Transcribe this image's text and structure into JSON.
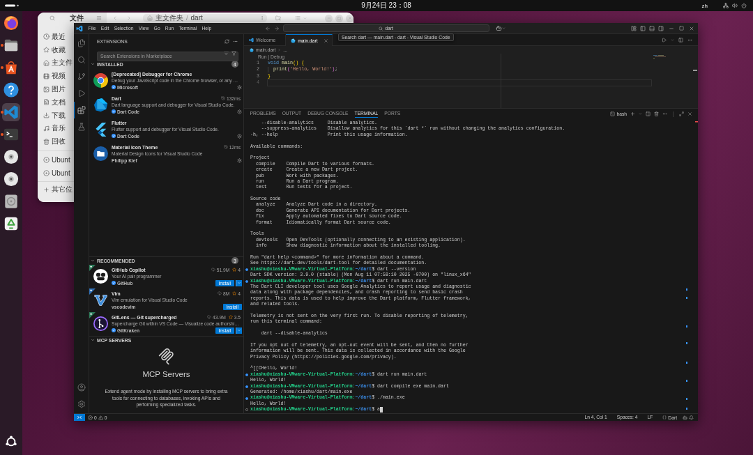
{
  "top_bar": {
    "clock": "9月24日 23：08",
    "input_method": "zh"
  },
  "dock": {
    "items": [
      {
        "kind": "firefox",
        "running": false,
        "selected": false
      },
      {
        "kind": "files",
        "running": true,
        "selected": false
      },
      {
        "kind": "app-center",
        "running": true,
        "selected": false
      },
      {
        "kind": "help",
        "running": false,
        "selected": false
      },
      {
        "kind": "vscode",
        "running": true,
        "selected": true
      },
      {
        "kind": "terminal",
        "running": true,
        "selected": false
      },
      {
        "kind": "disc",
        "running": false,
        "selected": false
      },
      {
        "kind": "disc",
        "running": false,
        "selected": false
      },
      {
        "kind": "drive",
        "running": false,
        "selected": false
      },
      {
        "kind": "trash",
        "running": false,
        "selected": false
      }
    ]
  },
  "file_manager": {
    "title": "文件",
    "path": [
      "主文件夹",
      "dart"
    ],
    "separator": "/",
    "places": [
      {
        "kind": "clock",
        "label": "最近"
      },
      {
        "kind": "star",
        "label": "收藏"
      },
      {
        "kind": "home",
        "label": "主文件"
      },
      {
        "kind": "video",
        "label": "视频"
      },
      {
        "kind": "image",
        "label": "图片"
      },
      {
        "kind": "document",
        "label": "文档"
      },
      {
        "kind": "download",
        "label": "下载"
      },
      {
        "kind": "music",
        "label": "音乐"
      },
      {
        "kind": "trash",
        "label": "回收"
      }
    ],
    "devices": [
      {
        "kind": "disc",
        "label": "Ubunt"
      },
      {
        "kind": "disc",
        "label": "Ubunt"
      }
    ],
    "other": {
      "kind": "plus",
      "label": "其它位"
    }
  },
  "vscode": {
    "menu": [
      "File",
      "Edit",
      "Selection",
      "View",
      "Go",
      "Run",
      "Terminal",
      "Help"
    ],
    "command_center": "dart",
    "tooltip": "Search dart — main.dart - dart - Visual Studio Code",
    "activity_bar": [
      {
        "kind": "explorer",
        "selected": false
      },
      {
        "kind": "search",
        "selected": false
      },
      {
        "kind": "source-control",
        "selected": false
      },
      {
        "kind": "run-debug",
        "selected": false
      },
      {
        "kind": "extensions",
        "selected": true
      },
      {
        "kind": "testing",
        "selected": false
      }
    ],
    "sidebar": {
      "title": "EXTENSIONS",
      "search": {
        "placeholder": "Search Extensions in Marketplace"
      },
      "installed": {
        "title": "INSTALLED",
        "count": "4",
        "expanded": true,
        "items": [
          {
            "kind": "chrome",
            "name": "[Deprecated] Debugger for Chrome",
            "description": "Debug your JavaScript code in the Chrome browser, or any …",
            "publisher": "Microsoft",
            "verified": true
          },
          {
            "kind": "dart",
            "name": "Dart",
            "activation_time": "132ms",
            "description": "Dart language support and debugger for Visual Studio Code.",
            "publisher": "Dart Code",
            "verified": true
          },
          {
            "kind": "flutter",
            "name": "Flutter",
            "description": "Flutter support and debugger for Visual Studio Code.",
            "publisher": "Dart Code",
            "verified": true
          },
          {
            "kind": "material",
            "name": "Material Icon Theme",
            "activation_time": "12ms",
            "description": "Material Design Icons for Visual Studio Code",
            "publisher": "Philipp Kief",
            "verified": false
          }
        ]
      },
      "recommended": {
        "title": "RECOMMENDED",
        "count": "3",
        "expanded": true,
        "items": [
          {
            "kind": "copilot",
            "name": "GitHub Copilot",
            "installs": "51.9M",
            "rating": "4",
            "description": "Your AI pair programmer",
            "publisher": "GitHub",
            "verified": true,
            "color": "#2e7d5b",
            "button": "Install",
            "split": true
          },
          {
            "kind": "vim",
            "name": "Vim",
            "installs": "8M",
            "rating": "4",
            "description": "Vim emulation for Visual Studio Code",
            "publisher": "vscodevim",
            "verified": false,
            "color": "#2f6fb5",
            "button": "Install",
            "split": false
          },
          {
            "kind": "gitlens",
            "name": "GitLens — Git supercharged",
            "installs": "43.9M",
            "rating": "3.5",
            "description": "Supercharge Git within VS Code — Visualize code authorshi…",
            "publisher": "GitKraken",
            "verified": true,
            "color": "#2e7d5b",
            "button": "Install",
            "split": true
          }
        ]
      },
      "mcp": {
        "title": "MCP SERVERS",
        "expanded": true,
        "heading": "MCP Servers",
        "description": "Extend agent mode by installing MCP servers to bring extra tools for connecting to databases, invoking APIs and performing specialized tasks."
      }
    },
    "tabs": [
      {
        "label": "Welcome",
        "kind": "welcome",
        "selected": false
      },
      {
        "label": "main.dart",
        "kind": "dart",
        "selected": true
      }
    ],
    "breadcrumb": [
      "main.dart",
      "..."
    ],
    "codelens": "Run | Debug",
    "code": [
      {
        "number": "1",
        "current": false,
        "indent": false,
        "tokens": [
          {
            "kind": "keyword",
            "text": "void "
          },
          {
            "kind": "function",
            "text": "main"
          },
          {
            "kind": "bracket",
            "text": "() {"
          }
        ]
      },
      {
        "number": "2",
        "current": false,
        "indent": true,
        "tokens": [
          {
            "kind": "function",
            "text": "print"
          },
          {
            "kind": "bracket2",
            "text": "("
          },
          {
            "kind": "string",
            "text": "'Hello, World!'"
          },
          {
            "kind": "bracket2",
            "text": ")"
          },
          {
            "kind": "plain",
            "text": ";"
          }
        ]
      },
      {
        "number": "3",
        "current": false,
        "indent": false,
        "tokens": [
          {
            "kind": "bracket",
            "text": "}"
          }
        ]
      },
      {
        "number": "4",
        "current": true,
        "indent": false
      }
    ],
    "panel": {
      "tabs": [
        {
          "label": "PROBLEMS",
          "selected": false
        },
        {
          "label": "OUTPUT",
          "selected": false
        },
        {
          "label": "DEBUG CONSOLE",
          "selected": false
        },
        {
          "label": "TERMINAL",
          "selected": true
        },
        {
          "label": "PORTS",
          "selected": false
        }
      ],
      "shell": "bash",
      "lines": [
        {
          "kind": "output",
          "text": "    --disable-analytics     Disable analytics."
        },
        {
          "kind": "output",
          "text": "    --suppress-analytics    Disallow analytics for this `dart *` run without changing the analytics configuration."
        },
        {
          "kind": "output",
          "text": "-h, --help                  Print this usage information."
        },
        {
          "kind": "blank"
        },
        {
          "kind": "output",
          "text": "Available commands:"
        },
        {
          "kind": "blank"
        },
        {
          "kind": "output",
          "text": "Project"
        },
        {
          "kind": "output",
          "text": "  compile    Compile Dart to various formats."
        },
        {
          "kind": "output",
          "text": "  create     Create a new Dart project."
        },
        {
          "kind": "output",
          "text": "  pub        Work with packages."
        },
        {
          "kind": "output",
          "text": "  run        Run a Dart program."
        },
        {
          "kind": "output",
          "text": "  test       Run tests for a project."
        },
        {
          "kind": "blank"
        },
        {
          "kind": "output",
          "text": "Source code"
        },
        {
          "kind": "output",
          "text": "  analyze    Analyze Dart code in a directory."
        },
        {
          "kind": "output",
          "text": "  doc        Generate API documentation for Dart projects."
        },
        {
          "kind": "output",
          "text": "  fix        Apply automated fixes to Dart source code."
        },
        {
          "kind": "output",
          "text": "  format     Idiomatically format Dart source code."
        },
        {
          "kind": "blank"
        },
        {
          "kind": "output",
          "text": "Tools"
        },
        {
          "kind": "output",
          "text": "  devtools   Open DevTools (optionally connecting to an existing application)."
        },
        {
          "kind": "output",
          "text": "  info       Show diagnostic information about the installed tooling."
        },
        {
          "kind": "blank"
        },
        {
          "kind": "output",
          "text": "Run \"dart help <command>\" for more information about a command."
        },
        {
          "kind": "output",
          "text": "See https://dart.dev/tools/dart-tool for detailed documentation."
        },
        {
          "kind": "prompt",
          "host": "xiashu@xiashu-VMware-Virtual-Platform:",
          "path": "~/dart",
          "command": "$ dart --version",
          "cursor": false
        },
        {
          "kind": "output",
          "text": "Dart SDK version: 3.9.0 (stable) (Mon Aug 11 07:58:10 2025 -0700) on \"linux_x64\""
        },
        {
          "kind": "prompt",
          "host": "xiashu@xiashu-VMware-Virtual-Platform:",
          "path": "~/dart",
          "command": "$ dart run main.dart",
          "cursor": false
        },
        {
          "kind": "output",
          "text": "The Dart CLI developer tool uses Google Analytics to report usage and diagnostic"
        },
        {
          "kind": "output",
          "text": "data along with package dependencies, and crash reporting to send basic crash"
        },
        {
          "kind": "output",
          "text": "reports. This data is used to help improve the Dart platform, Flutter framework,"
        },
        {
          "kind": "output",
          "text": "and related tools."
        },
        {
          "kind": "blank"
        },
        {
          "kind": "output",
          "text": "Telemetry is not sent on the very first run. To disable reporting of telemetry,"
        },
        {
          "kind": "output",
          "text": "run this terminal command:"
        },
        {
          "kind": "blank"
        },
        {
          "kind": "output",
          "text": "    dart --disable-analytics"
        },
        {
          "kind": "blank"
        },
        {
          "kind": "output",
          "text": "If you opt out of telemetry, an opt-out event will be sent, and then no further"
        },
        {
          "kind": "output",
          "text": "information will be sent. This data is collected in accordance with the Google"
        },
        {
          "kind": "output",
          "text": "Privacy Policy (https://policies.google.com/privacy)."
        },
        {
          "kind": "blank"
        },
        {
          "kind": "output",
          "text": "^[[CHello, World!"
        },
        {
          "kind": "prompt",
          "host": "xiashu@xiashu-VMware-Virtual-Platform:",
          "path": "~/dart",
          "command": "$ dart run main.dart",
          "cursor": false
        },
        {
          "kind": "output",
          "text": "Hello, World!"
        },
        {
          "kind": "prompt",
          "host": "xiashu@xiashu-VMware-Virtual-Platform:",
          "path": "~/dart",
          "command": "$ dart compile exe main.dart",
          "cursor": false
        },
        {
          "kind": "output",
          "text": "Generated: /home/xiashu/dart/main.exe"
        },
        {
          "kind": "prompt",
          "host": "xiashu@xiashu-VMware-Virtual-Platform:",
          "path": "~/dart",
          "command": "$ ./main.exe",
          "cursor": false
        },
        {
          "kind": "output",
          "text": "Hello, World!"
        },
        {
          "kind": "prompt",
          "host": "xiashu@xiashu-VMware-Virtual-Platform:",
          "path": "~/dart",
          "command": "$ a",
          "cursor": true
        }
      ]
    },
    "status_bar": {
      "errors": "0",
      "warnings": "0",
      "items": [
        "Ln 4, Col 1",
        "Spaces: 4",
        "LF"
      ],
      "language": "Dart"
    }
  }
}
